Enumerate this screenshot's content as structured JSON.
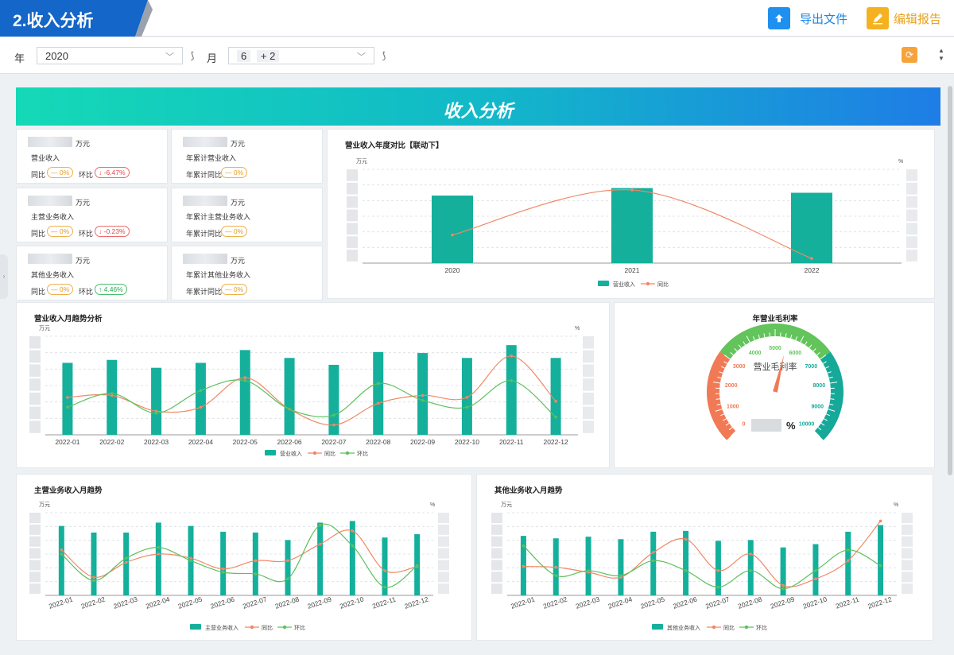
{
  "header": {
    "title": "2.收入分析",
    "export_label": "导出文件",
    "edit_label": "编辑报告"
  },
  "filters": {
    "year_label": "年",
    "year_value": "2020",
    "month_label": "月",
    "month_value": "6",
    "month_more": "+ 2"
  },
  "banner": {
    "title": "收入分析"
  },
  "kpis": [
    {
      "unit": "万元",
      "name": "营业收入",
      "items": [
        {
          "label": "同比",
          "badge": "— 0%",
          "tone": "o"
        },
        {
          "label": "环比",
          "badge": "↓ -6.47%",
          "tone": "r"
        }
      ]
    },
    {
      "unit": "万元",
      "name": "年累计营业收入",
      "items": [
        {
          "label": "年累计同比",
          "badge": "— 0%",
          "tone": "o"
        }
      ]
    },
    {
      "unit": "万元",
      "name": "主营业务收入",
      "items": [
        {
          "label": "同比",
          "badge": "— 0%",
          "tone": "o"
        },
        {
          "label": "环比",
          "badge": "↓ -0.23%",
          "tone": "r"
        }
      ]
    },
    {
      "unit": "万元",
      "name": "年累计主营业务收入",
      "items": [
        {
          "label": "年累计同比",
          "badge": "— 0%",
          "tone": "o"
        }
      ]
    },
    {
      "unit": "万元",
      "name": "其他业务收入",
      "items": [
        {
          "label": "同比",
          "badge": "— 0%",
          "tone": "o"
        },
        {
          "label": "环比",
          "badge": "↑ 4.46%",
          "tone": "g"
        }
      ]
    },
    {
      "unit": "万元",
      "name": "年累计其他业务收入",
      "items": [
        {
          "label": "年累计同比",
          "badge": "— 0%",
          "tone": "o"
        }
      ]
    }
  ],
  "colors": {
    "bar": "#14b09c",
    "yoy": "#f08866",
    "mom": "#5cc05c",
    "gauge_low": "#f07a55",
    "gauge_mid": "#62c45a",
    "gauge_high": "#16a99a"
  },
  "chart_data": [
    {
      "type": "bar",
      "title": "营业收入年度对比【联动下】",
      "ylabel": "万元",
      "y2label": "%",
      "categories": [
        "2020",
        "2021",
        "2022"
      ],
      "series": [
        {
          "name": "营业收入",
          "values": [
            72,
            80,
            75
          ]
        },
        {
          "name": "同比",
          "kind": "line",
          "values": [
            30,
            78,
            5
          ]
        }
      ],
      "ylim": [
        0,
        100
      ],
      "grid": true,
      "legend": "bottom"
    },
    {
      "type": "bar",
      "title": "营业收入月趋势分析",
      "ylabel": "万元",
      "y2label": "%",
      "categories": [
        "2022-01",
        "2022-02",
        "2022-03",
        "2022-04",
        "2022-05",
        "2022-06",
        "2022-07",
        "2022-08",
        "2022-09",
        "2022-10",
        "2022-11",
        "2022-12"
      ],
      "series": [
        {
          "name": "营业收入",
          "values": [
            73,
            76,
            68,
            73,
            86,
            78,
            71,
            84,
            83,
            78,
            91,
            78
          ]
        },
        {
          "name": "同比",
          "kind": "line",
          "values": [
            38,
            40,
            24,
            28,
            58,
            26,
            10,
            32,
            40,
            38,
            80,
            34
          ]
        },
        {
          "name": "环比",
          "kind": "line",
          "values": [
            28,
            42,
            22,
            45,
            55,
            26,
            20,
            52,
            35,
            28,
            55,
            18
          ]
        }
      ],
      "ylim": [
        0,
        100
      ],
      "grid": true,
      "legend": "bottom"
    },
    {
      "type": "gauge",
      "title": "年营业毛利率",
      "label": "营业毛利率",
      "unit": "%",
      "ticks": [
        "0",
        "1000",
        "2000",
        "3000",
        "4000",
        "5000",
        "6000",
        "7000",
        "8000",
        "9000",
        "10000"
      ],
      "min": 0,
      "max": 10000,
      "value": 5500
    },
    {
      "type": "bar",
      "title": "主营业务收入月趋势",
      "ylabel": "万元",
      "y2label": "%",
      "categories": [
        "2022-01",
        "2022-02",
        "2022-03",
        "2022-04",
        "2022-05",
        "2022-06",
        "2022-07",
        "2022-08",
        "2022-09",
        "2022-10",
        "2022-11",
        "2022-12"
      ],
      "series": [
        {
          "name": "主营业务收入",
          "values": [
            84,
            76,
            76,
            88,
            84,
            77,
            76,
            67,
            88,
            90,
            70,
            74
          ]
        },
        {
          "name": "同比",
          "kind": "line",
          "values": [
            55,
            22,
            40,
            50,
            45,
            32,
            42,
            42,
            62,
            78,
            30,
            35
          ]
        },
        {
          "name": "环比",
          "kind": "line",
          "values": [
            50,
            18,
            45,
            58,
            42,
            28,
            26,
            20,
            85,
            60,
            10,
            36
          ]
        }
      ],
      "ylim": [
        0,
        100
      ],
      "grid": true,
      "legend": "bottom"
    },
    {
      "type": "bar",
      "title": "其他业务收入月趋势",
      "ylabel": "万元",
      "y2label": "%",
      "categories": [
        "2022-01",
        "2022-02",
        "2022-03",
        "2022-04",
        "2022-05",
        "2022-06",
        "2022-07",
        "2022-08",
        "2022-09",
        "2022-10",
        "2022-11",
        "2022-12"
      ],
      "series": [
        {
          "name": "其他业务收入",
          "values": [
            72,
            69,
            71,
            68,
            77,
            78,
            66,
            67,
            58,
            62,
            77,
            85
          ]
        },
        {
          "name": "同比",
          "kind": "line",
          "values": [
            35,
            34,
            28,
            22,
            52,
            68,
            30,
            50,
            12,
            20,
            42,
            90
          ]
        },
        {
          "name": "环比",
          "kind": "line",
          "values": [
            60,
            24,
            30,
            24,
            42,
            30,
            10,
            30,
            8,
            30,
            55,
            36
          ]
        }
      ],
      "ylim": [
        0,
        100
      ],
      "grid": true,
      "legend": "bottom"
    }
  ]
}
